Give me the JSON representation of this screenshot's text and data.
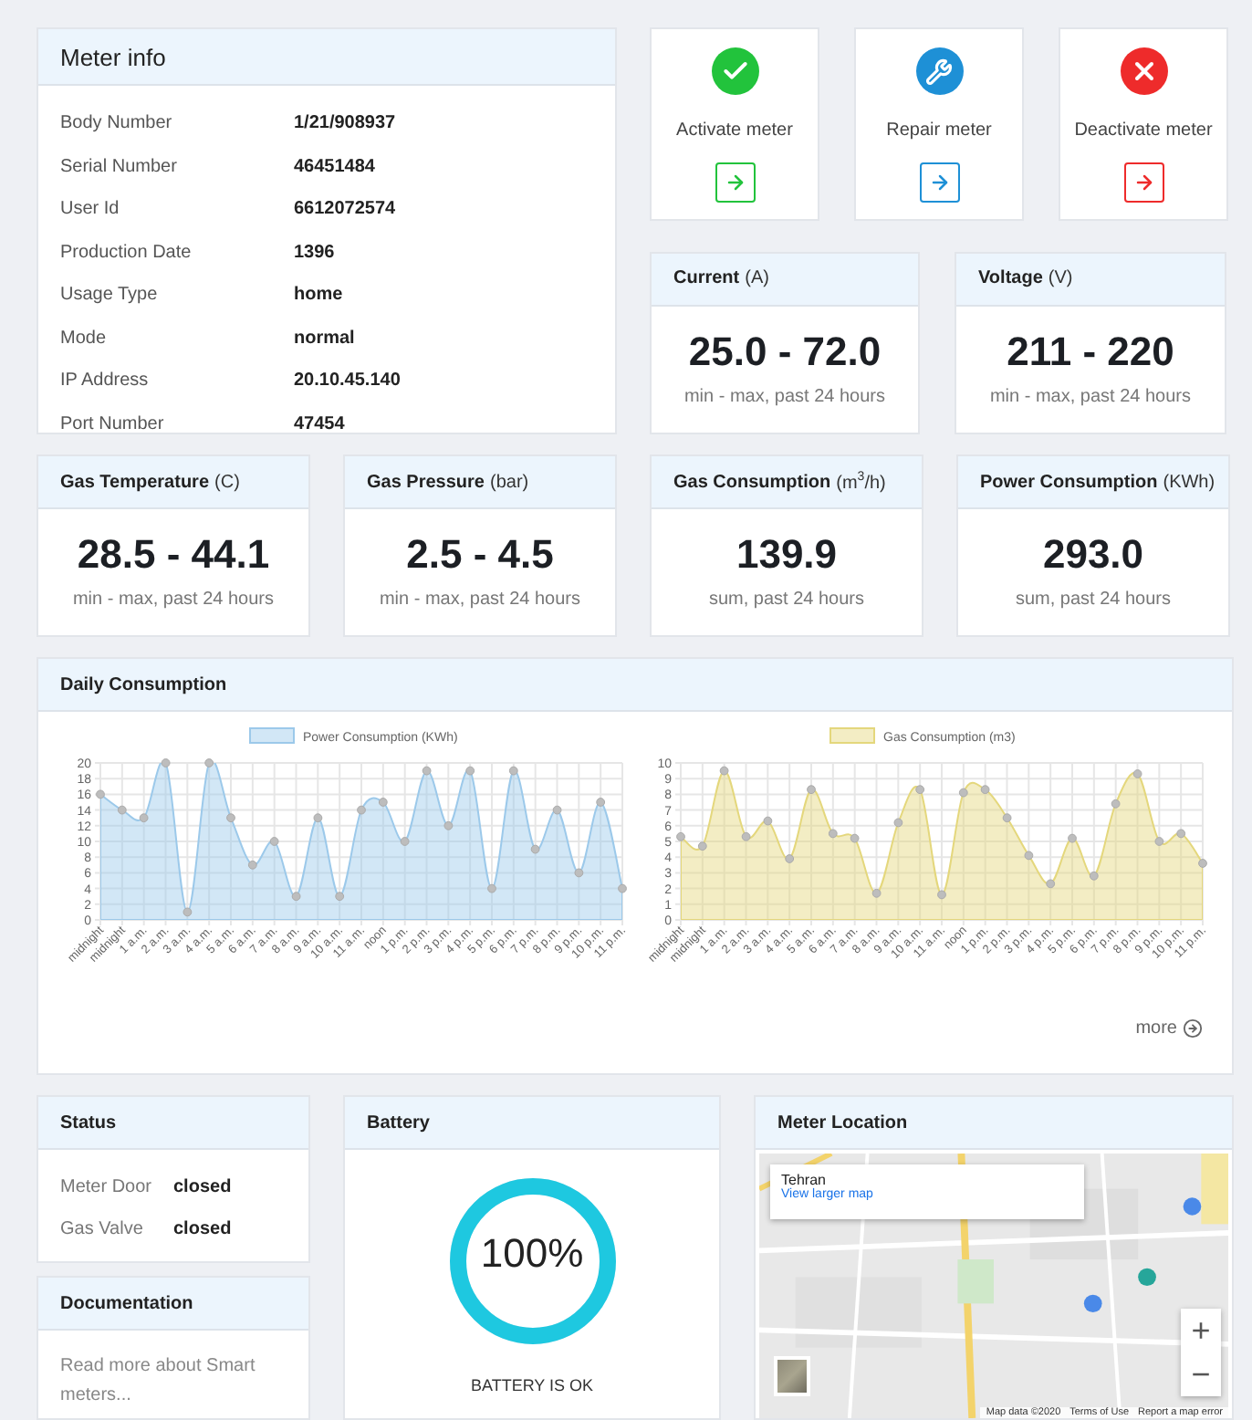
{
  "meter_info": {
    "title": "Meter info",
    "rows": [
      {
        "label": "Body Number",
        "value": "1/21/908937"
      },
      {
        "label": "Serial Number",
        "value": "46451484"
      },
      {
        "label": "User Id",
        "value": "6612072574"
      },
      {
        "label": "Production Date",
        "value": "1396"
      },
      {
        "label": "Usage Type",
        "value": "home"
      },
      {
        "label": "Mode",
        "value": "normal"
      },
      {
        "label": "IP Address",
        "value": "20.10.45.140"
      },
      {
        "label": "Port Number",
        "value": "47454"
      }
    ]
  },
  "actions": [
    {
      "kind": "activate",
      "label": "Activate meter",
      "color": "#22c33c"
    },
    {
      "kind": "repair",
      "label": "Repair meter",
      "color": "#1e90d6"
    },
    {
      "kind": "deactivate",
      "label": "Deactivate meter",
      "color": "#ee2b2b"
    }
  ],
  "stats": [
    {
      "title": "Current",
      "unit": "(A)",
      "value": "25.0 - 72.0",
      "caption": "min - max, past 24 hours"
    },
    {
      "title": "Voltage",
      "unit": "(V)",
      "value": "211 - 220",
      "caption": "min - max, past 24 hours"
    },
    {
      "title": "Gas Temperature",
      "unit": "(C)",
      "value": "28.5 - 44.1",
      "caption": "min - max, past 24 hours"
    },
    {
      "title": "Gas Pressure",
      "unit": "(bar)",
      "value": "2.5 - 4.5",
      "caption": "min - max, past 24 hours"
    },
    {
      "title": "Gas Consumption",
      "unit": "(m$^{3}$/h)",
      "value": "139.9",
      "caption": "sum, past 24 hours"
    },
    {
      "title": "Power Consumption",
      "unit": "(KWh)",
      "value": "293.0",
      "caption": "sum, past 24 hours"
    }
  ],
  "daily_consumption": {
    "title": "Daily Consumption",
    "more": "more",
    "charts": [
      {
        "chart_data": {
          "type": "area",
          "grid": true,
          "categories": [
            "midnight",
            "midnight",
            "1 a.m.",
            "2 a.m.",
            "3 a.m.",
            "4 a.m.",
            "5 a.m.",
            "6 a.m.",
            "7 a.m.",
            "8 a.m.",
            "9 a.m.",
            "10 a.m.",
            "11 a.m.",
            "noon",
            "1 p.m.",
            "2 p.m.",
            "3 p.m.",
            "4 p.m.",
            "5 p.m.",
            "6 p.m.",
            "7 p.m.",
            "8 p.m.",
            "9 p.m.",
            "10 p.m.",
            "11 p.m."
          ],
          "ylim": [
            0,
            20
          ],
          "yticks": [
            0,
            2,
            4,
            6,
            8,
            10,
            12,
            14,
            16,
            18,
            20
          ],
          "series": [
            {
              "name": "Power Consumption (KWh)",
              "color": "#9cc9ea",
              "values": [
                16,
                14,
                13,
                20,
                1,
                20,
                13,
                7,
                10,
                3,
                13,
                3,
                14,
                15,
                10,
                19,
                12,
                19,
                4,
                19,
                9,
                14,
                6,
                15,
                4
              ]
            }
          ]
        }
      },
      {
        "chart_data": {
          "type": "area",
          "grid": true,
          "categories": [
            "midnight",
            "midnight",
            "1 a.m.",
            "2 a.m.",
            "3 a.m.",
            "4 a.m.",
            "5 a.m.",
            "6 a.m.",
            "7 a.m.",
            "8 a.m.",
            "9 a.m.",
            "10 a.m.",
            "11 a.m.",
            "noon",
            "1 p.m.",
            "2 p.m.",
            "3 p.m.",
            "4 p.m.",
            "5 p.m.",
            "6 p.m.",
            "7 p.m.",
            "8 p.m.",
            "9 p.m.",
            "10 p.m.",
            "11 p.m."
          ],
          "ylim": [
            0,
            10
          ],
          "yticks": [
            0,
            1,
            2,
            3,
            4,
            5,
            6,
            7,
            8,
            9,
            10
          ],
          "series": [
            {
              "name": "Gas Consumption (m3)",
              "color": "#e4d77c",
              "values": [
                5.3,
                4.7,
                9.5,
                5.3,
                6.3,
                3.9,
                8.3,
                5.5,
                5.2,
                1.7,
                6.2,
                8.3,
                1.6,
                8.1,
                8.3,
                6.5,
                4.1,
                2.3,
                5.2,
                2.8,
                7.4,
                9.3,
                5.0,
                5.5,
                3.6
              ]
            }
          ]
        }
      }
    ]
  },
  "status": {
    "title": "Status",
    "rows": [
      {
        "label": "Meter Door",
        "value": "closed"
      },
      {
        "label": "Gas Valve",
        "value": "closed"
      }
    ]
  },
  "documentation": {
    "title": "Documentation",
    "text": "Read more about Smart meters..."
  },
  "battery": {
    "title": "Battery",
    "level": 1,
    "reading": "100%",
    "message": "BATTERY IS OK"
  },
  "map": {
    "title": "Meter Location",
    "kind": "picture",
    "place": "Tehran",
    "link": "View larger map",
    "zoom_in": "+",
    "zoom_out": "−",
    "attribution": [
      "Map data ©2020",
      "Terms of Use",
      "Report a map error"
    ]
  }
}
